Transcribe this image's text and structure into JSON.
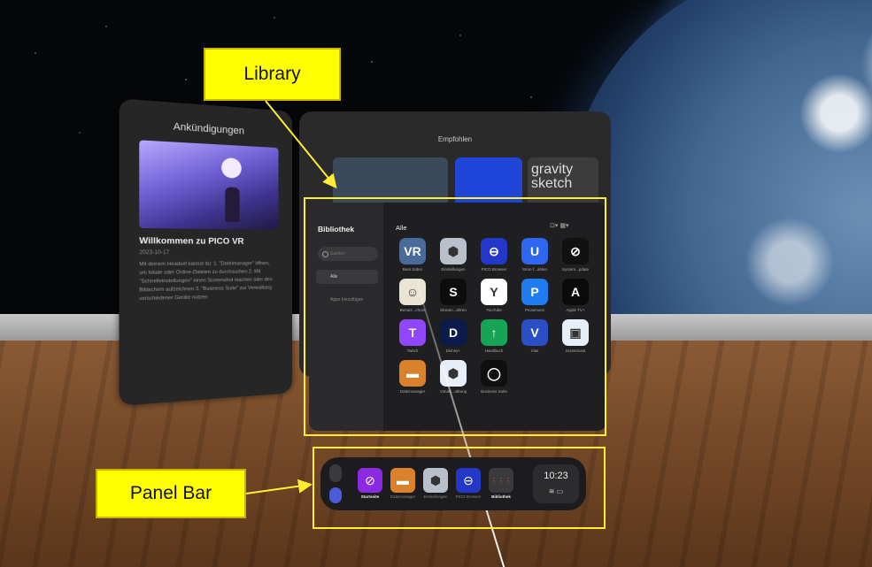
{
  "annotations": {
    "library_label": "Library",
    "panel_bar_label": "Panel Bar"
  },
  "announcements": {
    "title": "Ankündigungen",
    "headline": "Willkommen zu PICO VR",
    "date": "2023-10-17",
    "body": "Mit deinem Headset kannst du: 1. \"Dateimanager\" öffnen, um lokale oder Online-Dateien zu durchsuchen 2. Mit \"Schnelleinstellungen\" einen Screenshot machen oder den Bildschirm aufzeichnen 3. \"Business Suite\" zur Verwaltung verschiedener Geräte nutzen"
  },
  "recommended": {
    "title": "Empfohlen",
    "tile3_text": "gravity sketch"
  },
  "library": {
    "title": "Bibliothek",
    "search_placeholder": "Suchen",
    "nav_all": "Alle",
    "nav_add": "Apps hinzufügen",
    "section": "Alle",
    "tools": "⊡▾  ▦▾",
    "apps": [
      {
        "label": "Beat Saber",
        "glyph": "VR",
        "icon": "vr-app-icon",
        "color": "#4a6a9a"
      },
      {
        "label": "Einstellungen",
        "glyph": "⬢",
        "icon": "settings-icon",
        "color": "#b9c0cc"
      },
      {
        "label": "PICO Browser",
        "glyph": "⊖",
        "icon": "browser-icon",
        "color": "#2337c9"
      },
      {
        "label": "Store f...ahlen",
        "glyph": "U",
        "icon": "store-icon",
        "color": "#2f66f0"
      },
      {
        "label": "System...pdate",
        "glyph": "⊘",
        "icon": "system-update-icon",
        "color": "#111111"
      },
      {
        "label": "Benutz...chum",
        "glyph": "☺",
        "icon": "user-icon",
        "color": "#e9e4d4"
      },
      {
        "label": "Stream...ahren",
        "glyph": "S",
        "icon": "stream-icon",
        "color": "#0d0d0d"
      },
      {
        "label": "YouTube",
        "glyph": "Y",
        "icon": "youtube-icon",
        "color": "#ffffff"
      },
      {
        "label": "Picasmuss",
        "glyph": "P",
        "icon": "picasmuss-icon",
        "color": "#1f7cf0"
      },
      {
        "label": "Apple TV+",
        "glyph": "A",
        "icon": "apple-tv-icon",
        "color": "#0b0b0b"
      },
      {
        "label": "Twitch",
        "glyph": "T",
        "icon": "twitch-icon",
        "color": "#9146ff"
      },
      {
        "label": "Disney+",
        "glyph": "D",
        "icon": "disney-icon",
        "color": "#0d1b4a"
      },
      {
        "label": "Handbuch",
        "glyph": "↑",
        "icon": "manual-icon",
        "color": "#17a455"
      },
      {
        "label": "Vias",
        "glyph": "V",
        "icon": "vias-icon",
        "color": "#2a4fc4"
      },
      {
        "label": "Screencast",
        "glyph": "▣",
        "icon": "screencast-icon",
        "color": "#e6eef8"
      },
      {
        "label": "Dateimanager",
        "glyph": "▬",
        "icon": "file-manager-icon",
        "color": "#d9822b"
      },
      {
        "label": "Virtuel...atbung",
        "glyph": "⬢",
        "icon": "virtual-icon",
        "color": "#e8eef8"
      },
      {
        "label": "Business Suite",
        "glyph": "◯",
        "icon": "business-suite-icon",
        "color": "#0f0f0f"
      }
    ]
  },
  "panel_bar": {
    "items": [
      {
        "label": "Startseite",
        "glyph": "⊘",
        "icon": "home-icon",
        "color": "#8a2be2"
      },
      {
        "label": "Dateimanager",
        "glyph": "▬",
        "icon": "file-manager-icon",
        "color": "#d9822b"
      },
      {
        "label": "Einstellungen",
        "glyph": "⬢",
        "icon": "settings-icon",
        "color": "#b9c0cc"
      },
      {
        "label": "PICO Browser",
        "glyph": "⊖",
        "icon": "browser-icon",
        "color": "#2337c9"
      },
      {
        "label": "Bibliothek",
        "glyph": "⋮⋮⋮",
        "icon": "library-icon",
        "color": "#3a3a3c"
      }
    ],
    "time": "10:23",
    "status": "≋ ▭"
  }
}
